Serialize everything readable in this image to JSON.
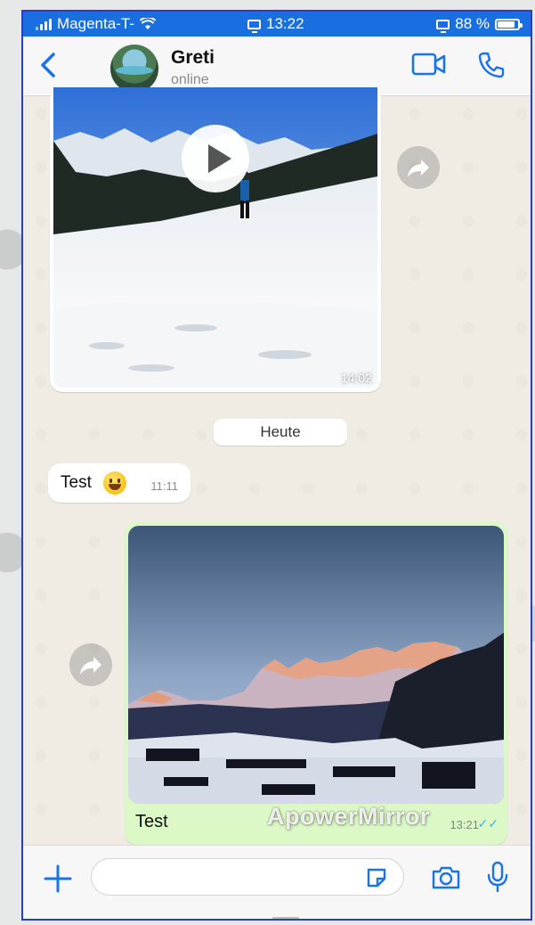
{
  "status_bar": {
    "carrier": "Magenta-T-",
    "time": "13:22",
    "battery": "88 %",
    "icons": [
      "signal-icon",
      "wifi-icon",
      "screen-mirror-icon",
      "battery-icon"
    ]
  },
  "header": {
    "contact_name": "Greti",
    "contact_status": "online",
    "icons": [
      "back-chevron-icon",
      "video-call-icon",
      "phone-call-icon"
    ]
  },
  "messages": {
    "video_message": {
      "time": "14:02",
      "icon": "play-icon"
    },
    "date_divider": "Heute",
    "incoming_text": {
      "text": "Test",
      "emoji": "grinning-face-emoji",
      "time": "11:11"
    },
    "outgoing_photo": {
      "caption": "Test",
      "time": "13:21",
      "status_icon": "double-check-icon"
    }
  },
  "watermark": "ApowerMirror",
  "input_bar": {
    "placeholder": "",
    "icons": [
      "plus-icon",
      "sticker-icon",
      "camera-icon",
      "microphone-icon"
    ]
  },
  "colors": {
    "accent": "#1a6fe0",
    "header_icon": "#1a73e8",
    "outgoing_bubble": "#dcf8c6",
    "incoming_bubble": "#ffffff",
    "chat_background": "#f1ece3",
    "read_ticks": "#34b7f1"
  }
}
